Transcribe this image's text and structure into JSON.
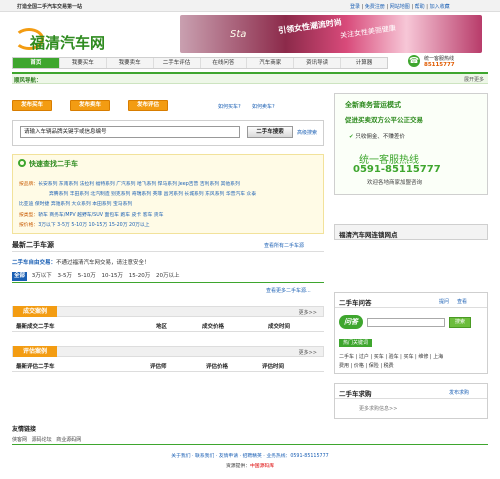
{
  "topbar": {
    "slogan": "打造全国二手汽车交易第一站",
    "links": [
      "登录",
      "免费注册",
      "网站地图",
      "帮助",
      "加入收藏"
    ]
  },
  "logo": {
    "text": "福清汽车网"
  },
  "banner": {
    "t0": "Sta",
    "t1": "引领女性潮流时尚",
    "t2": "关注女性美丽健康"
  },
  "nav": {
    "items": [
      "首页",
      "我要买车",
      "我要卖车",
      "二手车评估",
      "在线问答",
      "汽车商家",
      "资讯导读",
      "计算器"
    ],
    "hotline_label": "统一客服热线",
    "hotline": "85115777"
  },
  "green_bar": {
    "title": "顺风导航：",
    "right": "展开更多"
  },
  "actions": {
    "buttons": [
      "发布买车",
      "发布卖车",
      "发布评估"
    ],
    "links": [
      "如何买车?",
      "如何卖车?"
    ]
  },
  "search": {
    "value": "请输入车辆品牌关键字或信息编号",
    "button": "二手车搜索",
    "advanced": "高级搜索"
  },
  "quick_find": {
    "title": "快速查找二手车",
    "brand_label": "按品牌：",
    "brands_1": "长安系列 东南系列 法拉利 福特系列 广汽系列 哈飞系列 悍马系列 Jeep吉普 吉利系列 其他系列",
    "brands_2": "奔腾系列 丰田系列 北汽制造 别克系列 奇瑞系列 英菲 昌河系列 长城系列 东风系列 华普汽车 众泰",
    "brands_3": "比亚迪 保时捷 奔驰系列 大众系列 本田系列 宝马系列",
    "type_label": "按类型：",
    "types": "轿车 商务车/MPV 越野车/SUV 面包车 跑车 皮卡 客车 货车",
    "price_label": "按价格：",
    "prices": "3万以下 3-5万 5-10万 10-15万 15-20万 20万以上"
  },
  "latest": {
    "title": "最新二手车源",
    "more": "查看所有二手车源",
    "notice_label": "二手车自由交易：",
    "notice": "不通过福清汽车网交易，请注意安全！",
    "tab_all": "全部",
    "tabs": [
      "3万以下",
      "3-5万",
      "5-10万",
      "10-15万",
      "15-20万",
      "20万以上"
    ],
    "more2": "查看更多二手车源..."
  },
  "deals": {
    "title": "成交案例",
    "more": "更多>>",
    "cols": [
      "最新成交二手车",
      "地区",
      "成交价格",
      "成交时间"
    ]
  },
  "evals": {
    "title": "评估案例",
    "more": "更多>>",
    "cols": [
      "最新评估二手车",
      "评估师",
      "评估价格",
      "评估时间"
    ]
  },
  "links_section": {
    "title": "友情链接",
    "items": [
      "侠客网",
      "源码论坛",
      "商业源码网"
    ]
  },
  "right": {
    "ad_title": "全新商务营运模式",
    "ad_sub": "促进买卖双方公平公正交易",
    "bullet1": "只收佣金、不赚差价",
    "hotline_label": "统一客服热线",
    "hotline": "0591-85115777",
    "welcome": "欢迎各地商家加盟咨询",
    "network_title": "福清汽车网连锁网点",
    "qa_title": "二手车问答",
    "qa_links": [
      "提问",
      "查看"
    ],
    "qa_logo": "问答",
    "qa_btn": "搜索",
    "hot_label": "热门关键词",
    "keywords_1": "二手车 | 过户 | 买车 | 验车 | 买车 | 维修 | 上海",
    "keywords_2": "费用 | 价格 | 保险 | 税费",
    "buy_title": "二手车求购",
    "buy_link": "发布求购",
    "buy_more": "更多求购信息>>"
  },
  "footer": {
    "links": "关于我们 · 联系我们 · 友情申请 · 招聘精英 · 业务热线：0591-85115777",
    "support_label": "资源提供：",
    "support": "中国源码库"
  },
  "colors": {
    "green": "#3ea62e",
    "orange": "#f39c12",
    "link": "#1a5fb4"
  }
}
